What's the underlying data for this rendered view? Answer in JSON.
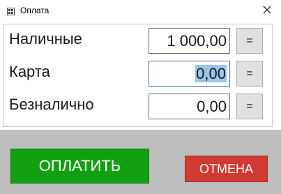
{
  "window": {
    "title": "Оплата"
  },
  "rows": [
    {
      "label": "Наличные",
      "value": "1 000,00",
      "button": "="
    },
    {
      "label": "Карта",
      "value": "0,00",
      "button": "="
    },
    {
      "label": "Безналично",
      "value": "0,00",
      "button": "="
    }
  ],
  "footer": {
    "pay_label": "ОПЛАТИТЬ",
    "cancel_label": "ОТМЕНА"
  },
  "colors": {
    "pay_button": "#12a012",
    "cancel_button": "#d13a30",
    "footer_bg": "#bdbdbd",
    "selection": "#9cc3ea"
  },
  "icons": {
    "app": "app-window-icon",
    "close": "close-icon"
  }
}
